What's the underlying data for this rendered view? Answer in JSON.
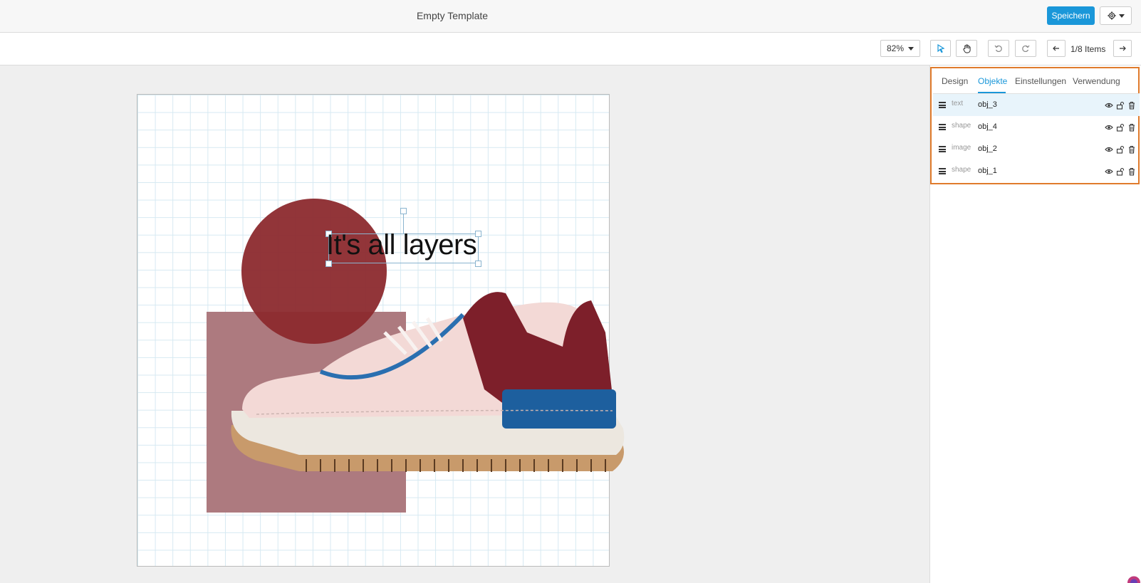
{
  "header": {
    "title": "Empty Template",
    "save_label": "Speichern",
    "settings_icon": "gear-icon"
  },
  "toolbar": {
    "zoom": "82%",
    "tools": [
      "pointer-icon",
      "hand-icon"
    ],
    "undo_icon": "undo-icon",
    "redo_icon": "redo-icon",
    "prev_icon": "arrow-left-icon",
    "next_icon": "arrow-right-icon",
    "items_label": "1/8 Items"
  },
  "canvas": {
    "text": "It's all layers",
    "colors": {
      "circle": "#8c2a2e",
      "rect": "#ad7a7f",
      "grid": "#d6e9f2"
    }
  },
  "panel": {
    "tabs": [
      {
        "label": "Design"
      },
      {
        "label": "Objekte"
      },
      {
        "label": "Einstellungen"
      },
      {
        "label": "Verwendung"
      }
    ],
    "active_tab": "Objekte",
    "objects": [
      {
        "type": "text",
        "name": "obj_3",
        "selected": true
      },
      {
        "type": "shape",
        "name": "obj_4",
        "selected": false
      },
      {
        "type": "image",
        "name": "obj_2",
        "selected": false
      },
      {
        "type": "shape",
        "name": "obj_1",
        "selected": false
      }
    ]
  },
  "colors": {
    "accent": "#1a97d9",
    "highlight_frame": "#e07b2c"
  }
}
